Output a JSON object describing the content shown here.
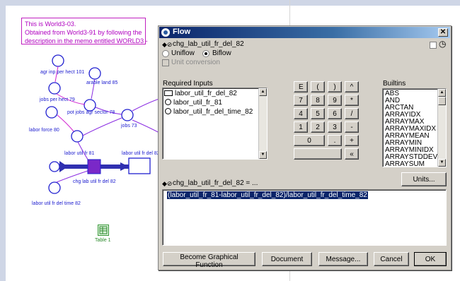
{
  "canvas": {
    "memo_lines": [
      "This is World3-03.",
      "Obtained from World3-91 by following the",
      "description in the memo entitled WORLD3 -"
    ],
    "labels": {
      "agr_inp": "agr inp per hect 101",
      "arable": "arable land 85",
      "jobs_per_hect": "jobs per hect 79",
      "pot_jobs": "pot jobs agr sector 78",
      "labor_force": "labor force 80",
      "jobs": "jobs 73",
      "labor_util": "labor util fr 81",
      "labor_util_del": "labor util fr del 82",
      "chg": "chg lab util fr del 82",
      "util_time": "labor util fr del time 82"
    },
    "table_label": "Table 1"
  },
  "dialog": {
    "title": "Flow",
    "variable_name": "chg_lab_util_fr_del_82",
    "uniflow_label": "Uniflow",
    "biflow_label": "Biflow",
    "unit_conversion_label": "Unit conversion",
    "required_inputs_label": "Required Inputs",
    "required_inputs": [
      {
        "name": "labor_util_fr_del_82",
        "kind": "stock"
      },
      {
        "name": "labor_util_fr_81",
        "kind": "converter"
      },
      {
        "name": "labor_util_fr_del_time_82",
        "kind": "converter"
      }
    ],
    "keypad": [
      [
        "E",
        "(",
        ")",
        "^"
      ],
      [
        "7",
        "8",
        "9",
        "*"
      ],
      [
        "4",
        "5",
        "6",
        "/"
      ],
      [
        "1",
        "2",
        "3",
        "-"
      ]
    ],
    "keypad_zero": "0",
    "keypad_dot": ".",
    "keypad_plus": "+",
    "keypad_back": "«",
    "builtins_label": "Builtins",
    "builtins": [
      "ABS",
      "AND",
      "ARCTAN",
      "ARRAYIDX",
      "ARRAYMAX",
      "ARRAYMAXIDX",
      "ARRAYMEAN",
      "ARRAYMIN",
      "ARRAYMINIDX",
      "ARRAYSTDDEV",
      "ARRAYSUM"
    ],
    "units_button": "Units...",
    "equation_label": "chg_lab_util_fr_del_82 = ...",
    "equation": "(labor_util_fr_81-labor_util_fr_del_82)/labor_util_fr_del_time_82",
    "buttons": {
      "graphical": "Become Graphical Function",
      "document": "Document",
      "message": "Message...",
      "cancel": "Cancel",
      "ok": "OK"
    }
  },
  "colors": {
    "title_bar": "#0a246a",
    "dialog_face": "#d4d0c8",
    "model_blue": "#2020d0",
    "model_magenta": "#c020c0",
    "model_purple": "#8a2be2"
  }
}
